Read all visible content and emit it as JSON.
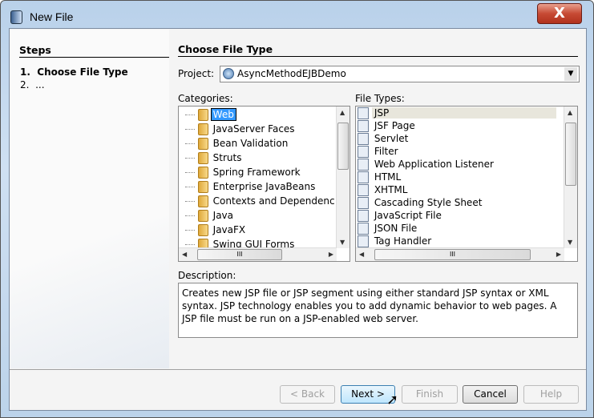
{
  "window": {
    "title": "New File",
    "close_label": "X"
  },
  "steps": {
    "heading": "Steps",
    "items": [
      {
        "num": "1.",
        "label": "Choose File Type"
      },
      {
        "num": "2.",
        "label": "..."
      }
    ]
  },
  "main": {
    "heading": "Choose File Type",
    "project_label": "Project:",
    "project_value": "AsyncMethodEJBDemo",
    "categories_label": "Categories:",
    "categories": [
      "Web",
      "JavaServer Faces",
      "Bean Validation",
      "Struts",
      "Spring Framework",
      "Enterprise JavaBeans",
      "Contexts and Dependenc",
      "Java",
      "JavaFX",
      "Swing GUI Forms"
    ],
    "selected_category": "Web",
    "file_types_label": "File Types:",
    "file_types": [
      "JSP",
      "JSF Page",
      "Servlet",
      "Filter",
      "Web Application Listener",
      "HTML",
      "XHTML",
      "Cascading Style Sheet",
      "JavaScript File",
      "JSON File",
      "Tag Handler"
    ],
    "selected_file_type": "JSP",
    "description_label": "Description:",
    "description": "Creates new JSP file or JSP segment using either standard JSP syntax or XML syntax. JSP technology enables you to add dynamic behavior to web pages. A JSP file must be run on a JSP-enabled web server."
  },
  "buttons": {
    "back": "< Back",
    "next": "Next >",
    "finish": "Finish",
    "cancel": "Cancel",
    "help": "Help"
  },
  "colors": {
    "selection": "#3399ff",
    "hover_row": "#e8e6dc"
  }
}
